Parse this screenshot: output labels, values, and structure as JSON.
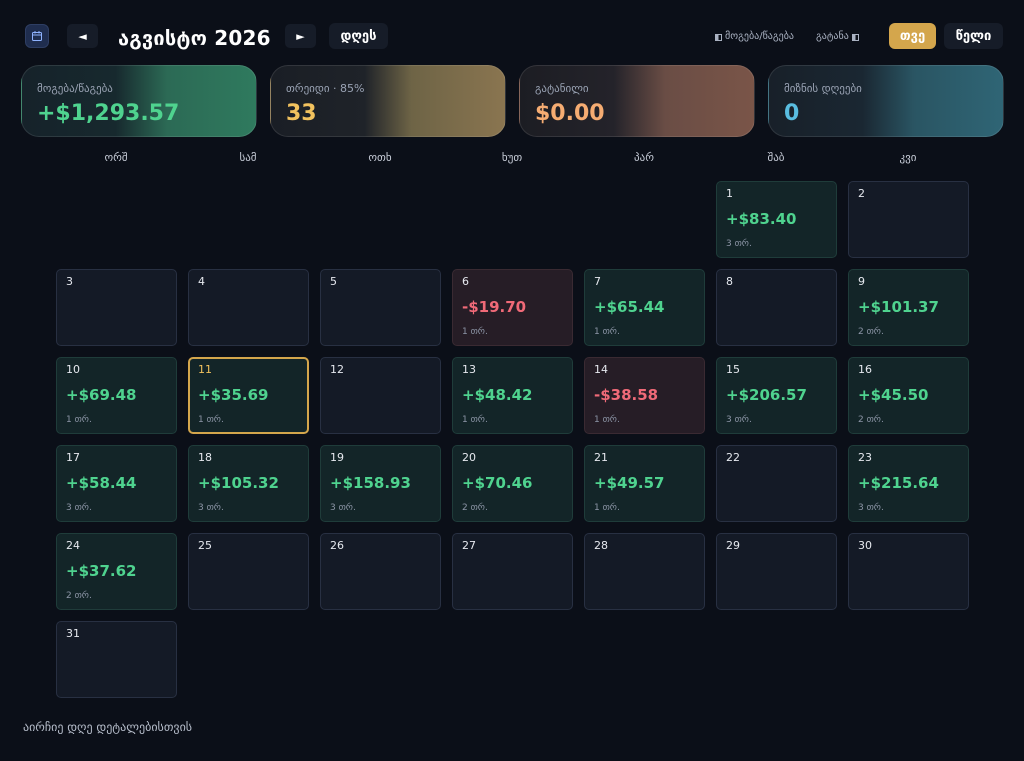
{
  "header": {
    "prev_label": "◄",
    "next_label": "►",
    "month_title": "აგვისტო 2026",
    "today_label": "დღეს",
    "toggle_pnl_label": "მოგება/წაგება",
    "toggle_withdrawal_label": "გატანა",
    "view_month_label": "თვე",
    "view_year_label": "წელი"
  },
  "stats": [
    {
      "label": "მოგება/წაგება",
      "value": "+$1,293.57"
    },
    {
      "label": "თრეიდი · 85%",
      "value": "33"
    },
    {
      "label": "გატანილი",
      "value": "$0.00"
    },
    {
      "label": "მიზნის დღეები",
      "value": "0"
    }
  ],
  "weekdays": [
    "ორშ",
    "სამ",
    "ოთხ",
    "ხუთ",
    "პარ",
    "შაბ",
    "კვი"
  ],
  "days": [
    {
      "day": "1",
      "pnl": "+$83.40",
      "count": "3 თრ.",
      "status": "win"
    },
    {
      "day": "2",
      "pnl": "",
      "count": "",
      "status": "none"
    },
    {
      "day": "3",
      "pnl": "",
      "count": "",
      "status": "none"
    },
    {
      "day": "4",
      "pnl": "",
      "count": "",
      "status": "none"
    },
    {
      "day": "5",
      "pnl": "",
      "count": "",
      "status": "none"
    },
    {
      "day": "6",
      "pnl": "-$19.70",
      "count": "1 თრ.",
      "status": "loss"
    },
    {
      "day": "7",
      "pnl": "+$65.44",
      "count": "1 თრ.",
      "status": "win"
    },
    {
      "day": "8",
      "pnl": "",
      "count": "",
      "status": "none"
    },
    {
      "day": "9",
      "pnl": "+$101.37",
      "count": "2 თრ.",
      "status": "win"
    },
    {
      "day": "10",
      "pnl": "+$69.48",
      "count": "1 თრ.",
      "status": "win"
    },
    {
      "day": "11",
      "pnl": "+$35.69",
      "count": "1 თრ.",
      "status": "win",
      "today": true
    },
    {
      "day": "12",
      "pnl": "",
      "count": "",
      "status": "none"
    },
    {
      "day": "13",
      "pnl": "+$48.42",
      "count": "1 თრ.",
      "status": "win"
    },
    {
      "day": "14",
      "pnl": "-$38.58",
      "count": "1 თრ.",
      "status": "loss"
    },
    {
      "day": "15",
      "pnl": "+$206.57",
      "count": "3 თრ.",
      "status": "win"
    },
    {
      "day": "16",
      "pnl": "+$45.50",
      "count": "2 თრ.",
      "status": "win"
    },
    {
      "day": "17",
      "pnl": "+$58.44",
      "count": "3 თრ.",
      "status": "win"
    },
    {
      "day": "18",
      "pnl": "+$105.32",
      "count": "3 თრ.",
      "status": "win"
    },
    {
      "day": "19",
      "pnl": "+$158.93",
      "count": "3 თრ.",
      "status": "win"
    },
    {
      "day": "20",
      "pnl": "+$70.46",
      "count": "2 თრ.",
      "status": "win"
    },
    {
      "day": "21",
      "pnl": "+$49.57",
      "count": "1 თრ.",
      "status": "win"
    },
    {
      "day": "22",
      "pnl": "",
      "count": "",
      "status": "none"
    },
    {
      "day": "23",
      "pnl": "+$215.64",
      "count": "3 თრ.",
      "status": "win"
    },
    {
      "day": "24",
      "pnl": "+$37.62",
      "count": "2 თრ.",
      "status": "win"
    },
    {
      "day": "25",
      "pnl": "",
      "count": "",
      "status": "none"
    },
    {
      "day": "26",
      "pnl": "",
      "count": "",
      "status": "none"
    },
    {
      "day": "27",
      "pnl": "",
      "count": "",
      "status": "none"
    },
    {
      "day": "28",
      "pnl": "",
      "count": "",
      "status": "none"
    },
    {
      "day": "29",
      "pnl": "",
      "count": "",
      "status": "none"
    },
    {
      "day": "30",
      "pnl": "",
      "count": "",
      "status": "none"
    },
    {
      "day": "31",
      "pnl": "",
      "count": "",
      "status": "none"
    }
  ],
  "footer_hint": "აირჩიე დღე დეტალებისთვის",
  "colors": {
    "background": "#0b0f18",
    "accent": "#d4a64c",
    "profit": "#4fd38f",
    "loss": "#f06a78"
  }
}
